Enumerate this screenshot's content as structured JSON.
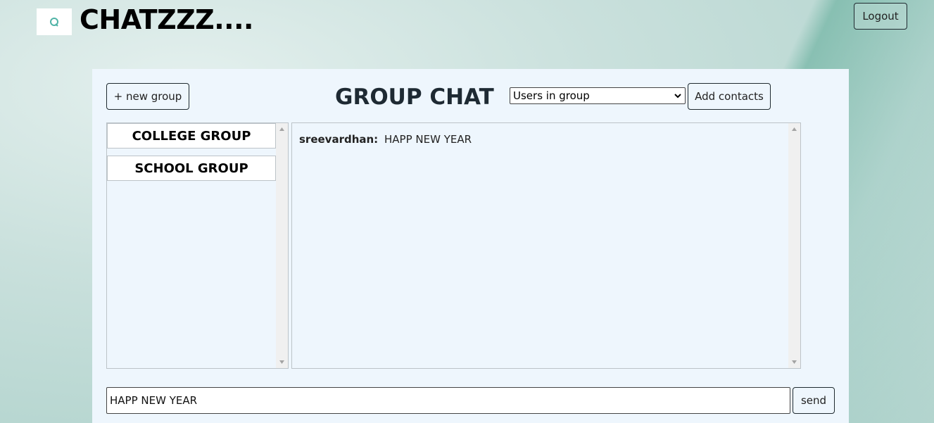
{
  "header": {
    "app_title": "CHATZZZ....",
    "logout_label": "Logout",
    "logo_icon": "chat-bubble-icon"
  },
  "toolbar": {
    "new_group_label": "+ new group",
    "page_title": "GROUP CHAT",
    "users_select": {
      "selected": "Users in group"
    },
    "add_contacts_label": "Add contacts"
  },
  "groups": {
    "items": [
      {
        "label": "COLLEGE GROUP"
      },
      {
        "label": "SCHOOL GROUP"
      }
    ]
  },
  "chat": {
    "messages": [
      {
        "sender": "sreevardhan:",
        "text": "HAPP NEW YEAR"
      }
    ]
  },
  "composer": {
    "input_value": "HAPP NEW YEAR",
    "send_label": "send"
  },
  "colors": {
    "panel_bg": "#eef6fd",
    "border": "#1f2a30",
    "logo_accent": "#4fb3a6"
  }
}
